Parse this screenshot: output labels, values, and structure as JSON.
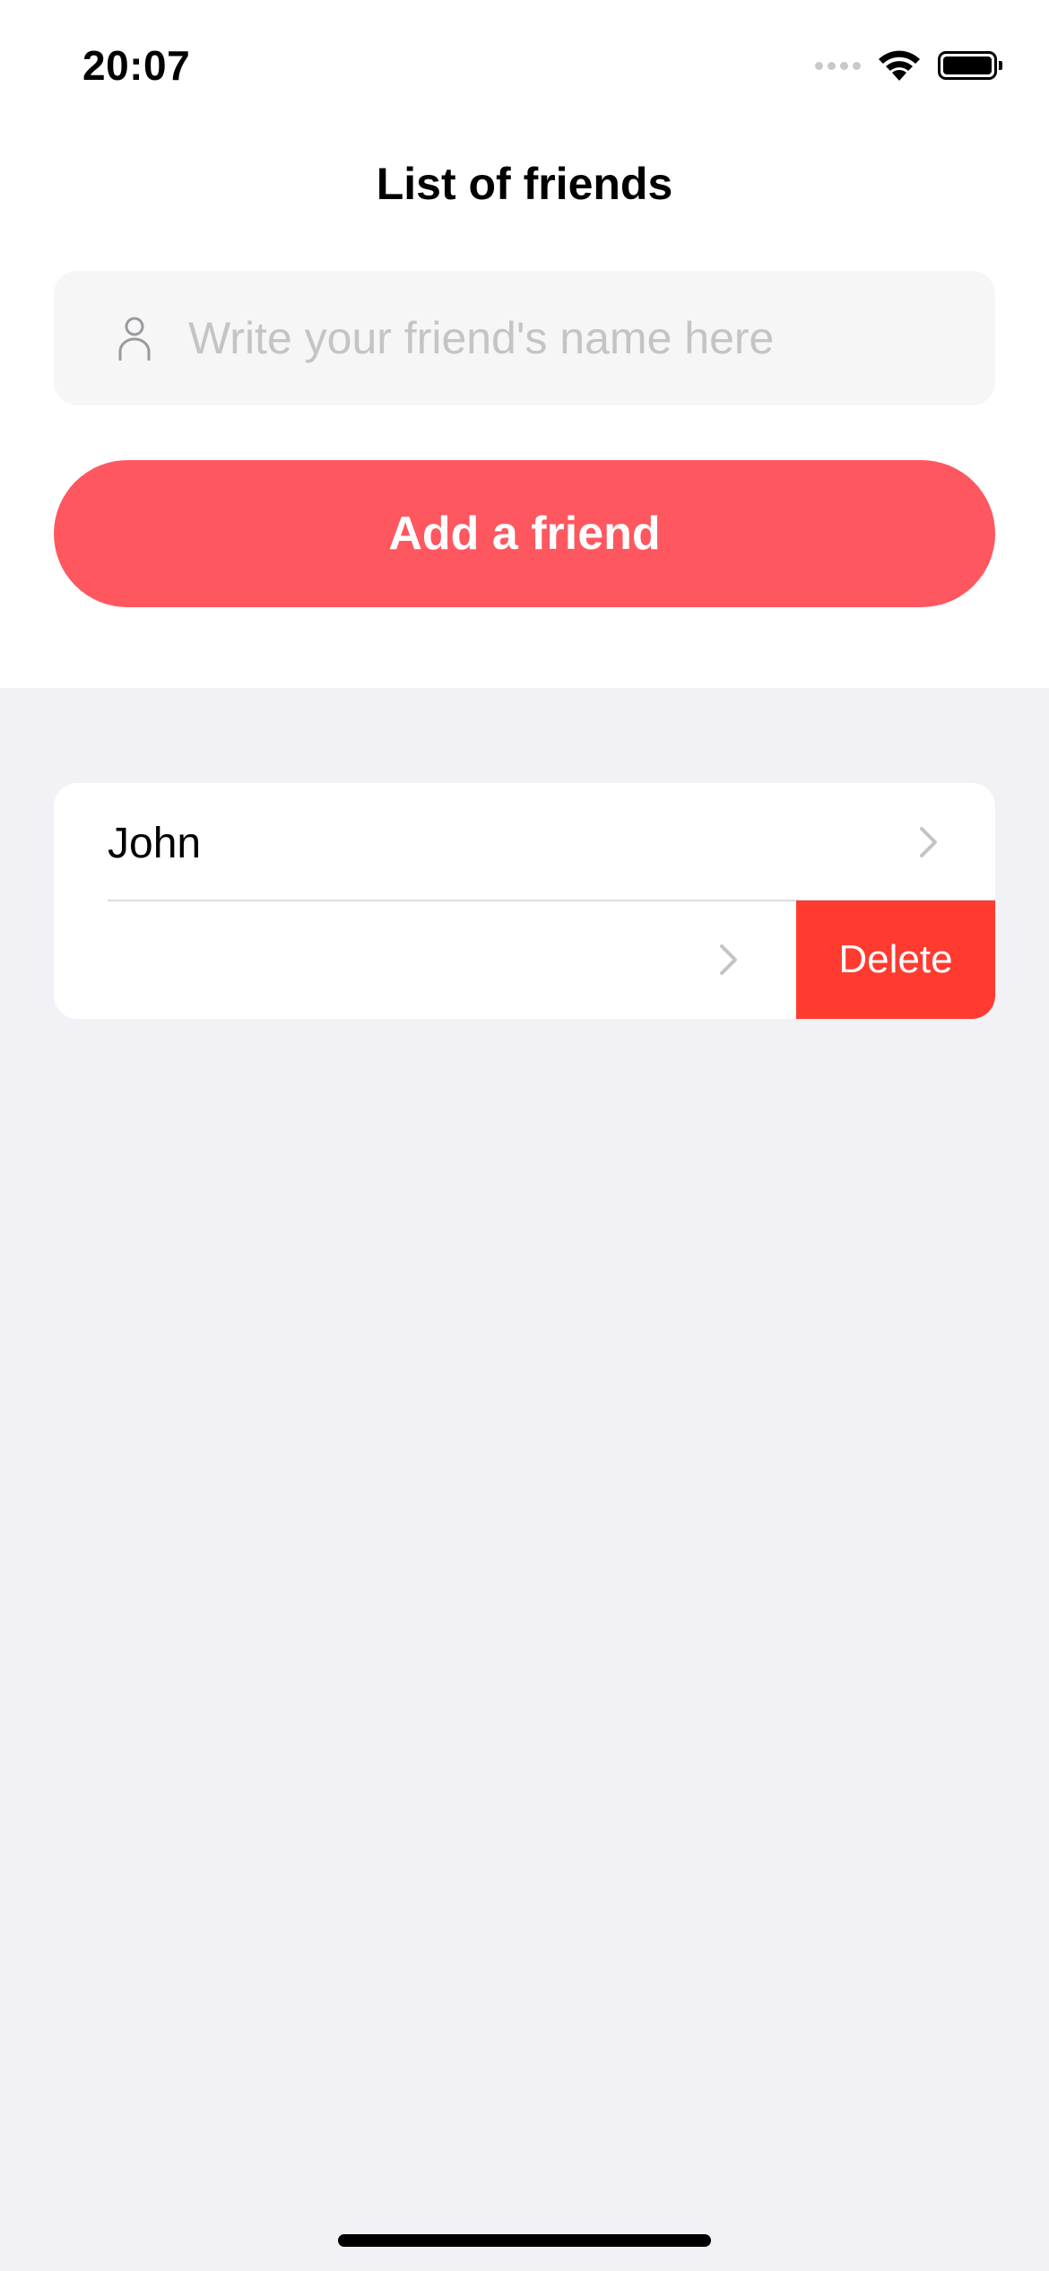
{
  "status_bar": {
    "time": "20:07",
    "icons": [
      "signal-dots-icon",
      "wifi-icon",
      "battery-icon"
    ]
  },
  "header": {
    "title": "List of friends"
  },
  "form": {
    "input_icon": "person-icon",
    "input_value": "",
    "input_placeholder": "Write your friend's name here",
    "add_button_label": "Add a friend"
  },
  "friends": [
    {
      "name": "John",
      "swiped": false
    },
    {
      "name": "",
      "swiped": true,
      "delete_label": "Delete"
    }
  ],
  "colors": {
    "accent": "#ff5760",
    "delete": "#ff3b30",
    "background": "#f1f1f6",
    "input_background": "#f6f6f7",
    "placeholder": "#c4c4c7"
  }
}
